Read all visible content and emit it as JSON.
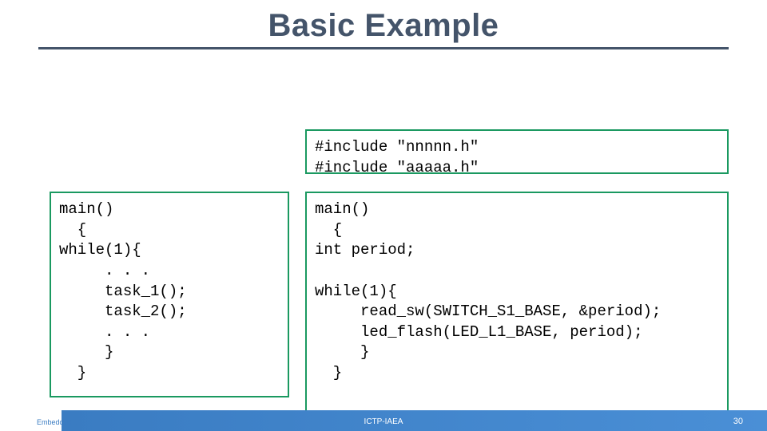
{
  "title": "Basic Example",
  "code_includes": "#include \"nnnnn.h\"\n#include \"aaaaa.h\"",
  "code_left": "main()\n  {\nwhile(1){\n     . . .\n     task_1();\n     task_2();\n     . . .\n     }\n  }",
  "code_right": "main()\n  {\nint period;\n\nwhile(1){\n     read_sw(SWITCH_S1_BASE, &period);\n     led_flash(LED_L1_BASE, period);\n     }\n  }",
  "footer": {
    "left": "Embedded c",
    "center": "ICTP-IAEA",
    "page": "30"
  }
}
